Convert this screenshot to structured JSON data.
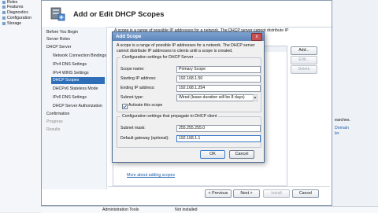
{
  "tree": {
    "items": [
      "Roles",
      "Features",
      "Diagnostics",
      "Configuration",
      "Storage"
    ]
  },
  "wizard": {
    "title": "Add or Edit DHCP Scopes",
    "description_line1": "A scope is a range of possible IP addresses for a network. The DHCP server cannot distribute IP",
    "description_line2": "",
    "nav": [
      {
        "label": "Before You Begin",
        "state": "normal",
        "level": 0
      },
      {
        "label": "Server Roles",
        "state": "normal",
        "level": 0
      },
      {
        "label": "DHCP Server",
        "state": "normal",
        "level": 0
      },
      {
        "label": "Network Connection Bindings",
        "state": "normal",
        "level": 1
      },
      {
        "label": "IPv4 DNS Settings",
        "state": "normal",
        "level": 1
      },
      {
        "label": "IPv4 WINS Settings",
        "state": "normal",
        "level": 1
      },
      {
        "label": "DHCP Scopes",
        "state": "selected",
        "level": 1
      },
      {
        "label": "DHCPv6 Stateless Mode",
        "state": "normal",
        "level": 1
      },
      {
        "label": "IPv6 DNS Settings",
        "state": "normal",
        "level": 1
      },
      {
        "label": "DHCP Server Authorization",
        "state": "normal",
        "level": 1
      },
      {
        "label": "Confirmation",
        "state": "normal",
        "level": 0
      },
      {
        "label": "Progress",
        "state": "disabled",
        "level": 0
      },
      {
        "label": "Results",
        "state": "disabled",
        "level": 0
      }
    ],
    "side_buttons": [
      "Add...",
      "Edit...",
      "Delete"
    ],
    "link": "More about adding scopes",
    "footer_buttons": [
      "< Previous",
      "Next >",
      "Install",
      "Cancel"
    ]
  },
  "dialog": {
    "title": "Add Scope",
    "close_glyph": "x",
    "description": "A scope is a range of possible IP addresses for a network. The DHCP server cannot distribute IP addresses to clients until a scope is created.",
    "group1_title": "Configuration settings for DHCP Server",
    "fields": {
      "scope_name_label": "Scope name:",
      "scope_name_value": "Primary Scope",
      "start_ip_label": "Starting IP address:",
      "start_ip_value": "192.168.1.50",
      "end_ip_label": "Ending IP address:",
      "end_ip_value": "192.168.1.254",
      "subnet_type_label": "Subnet type:",
      "subnet_type_value": "Wired (lease duration will be 8 days)",
      "activate_label": "Activate this scope",
      "activate_checked": true
    },
    "group2_title": "Configuration settings that propagate to DHCP client",
    "propagate": {
      "subnet_mask_label": "Subnet mask:",
      "subnet_mask_value": "255.255.255.0",
      "gateway_label": "Default gateway (optional):",
      "gateway_value": "192.168.1.1"
    },
    "ok": "OK",
    "cancel": "Cancel"
  },
  "right_panel": {
    "lines": [
      {
        "text": "earches.",
        "kind": "text"
      },
      {
        "text": "Domain",
        "kind": "link"
      },
      {
        "text": "ler",
        "kind": "link"
      }
    ]
  },
  "status_bar": {
    "left": "Administration Tools",
    "right": "Not installed"
  }
}
